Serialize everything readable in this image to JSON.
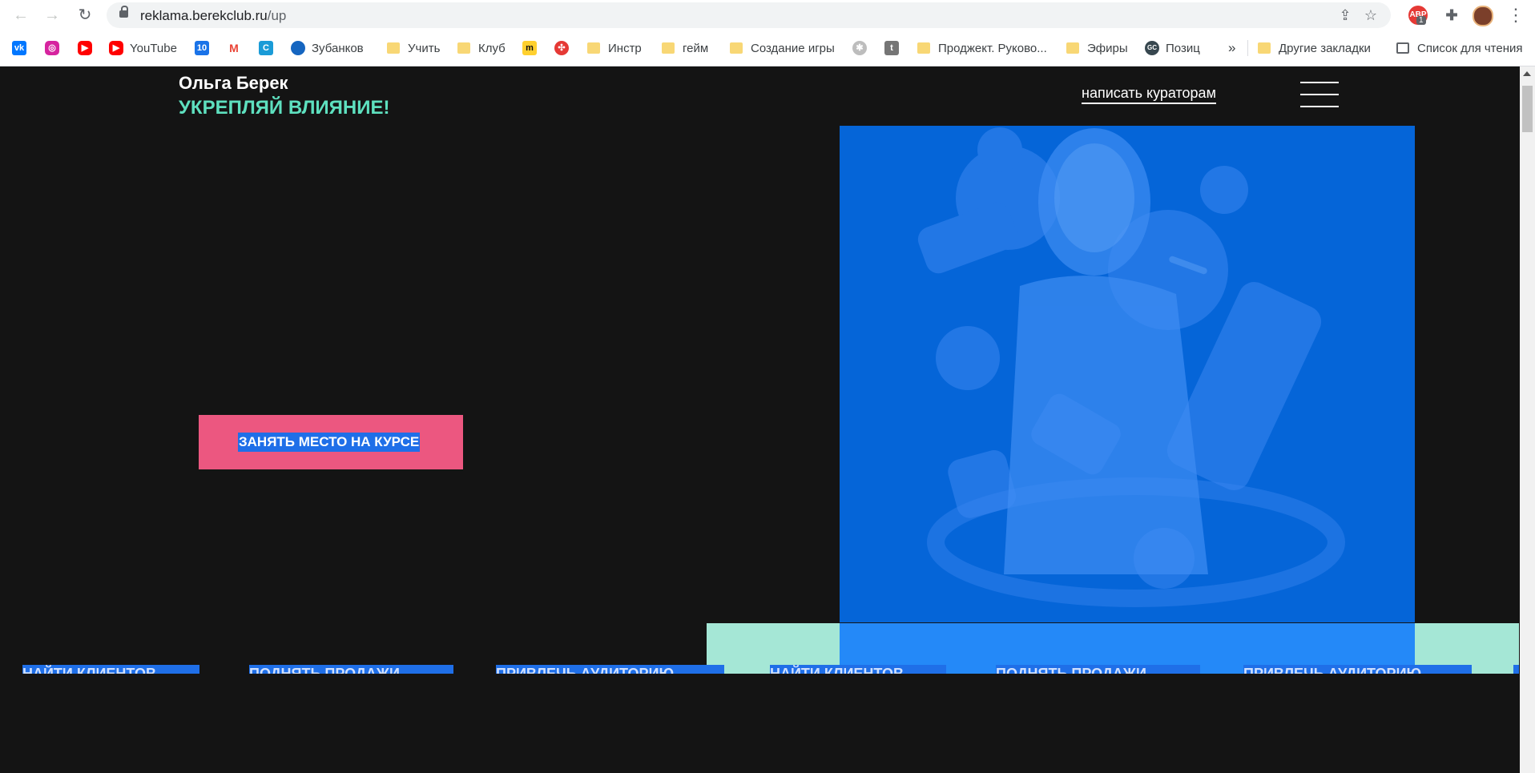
{
  "browser": {
    "url_host": "reklama.berekclub.ru",
    "url_path": "/up",
    "extension_badge": "1",
    "adblock_label": "ABP"
  },
  "bookmarks": [
    {
      "label": "",
      "icon": "vk-icon",
      "color": "#0077ff"
    },
    {
      "label": "",
      "icon": "instagram-icon",
      "color": "#d6249f"
    },
    {
      "label": "",
      "icon": "youtube-icon",
      "color": "#ff0000"
    },
    {
      "label": "YouTube",
      "icon": "youtube-icon",
      "color": "#ff0000"
    },
    {
      "label": "",
      "icon": "calendar-icon",
      "color": "#1a73e8"
    },
    {
      "label": "",
      "icon": "gmail-icon",
      "color": "#ea4335"
    },
    {
      "label": "",
      "icon": "c-icon",
      "color": "#1a9bd7"
    },
    {
      "label": "Зубанков",
      "icon": "cloud-icon",
      "color": "#1565c0"
    },
    {
      "label": "Учить",
      "icon": "folder-icon"
    },
    {
      "label": "Клуб",
      "icon": "folder-icon"
    },
    {
      "label": "",
      "icon": "miro-icon",
      "color": "#ffd02f"
    },
    {
      "label": "",
      "icon": "lifebuoy-icon",
      "color": "#e53935"
    },
    {
      "label": "Инстр",
      "icon": "folder-icon"
    },
    {
      "label": "гейм",
      "icon": "folder-icon"
    },
    {
      "label": "Создание игры",
      "icon": "folder-icon"
    },
    {
      "label": "",
      "icon": "gear-gray-icon",
      "color": "#bdbdbd"
    },
    {
      "label": "",
      "icon": "t-icon",
      "color": "#757575"
    },
    {
      "label": "Проджект. Руково...",
      "icon": "folder-icon"
    },
    {
      "label": "Эфиры",
      "icon": "folder-icon"
    },
    {
      "label": "Позиц",
      "icon": "gc-icon",
      "color": "#37474f"
    },
    {
      "label": "»",
      "icon": "more-bookmarks"
    },
    {
      "label": "Другие закладки",
      "icon": "folder-icon"
    },
    {
      "label": "Список для чтения",
      "icon": "reading-list-icon"
    }
  ],
  "header": {
    "name": "Ольга Берек",
    "slogan": "УКРЕПЛЯЙ ВЛИЯНИЕ!",
    "curators_link": "написать кураторам"
  },
  "hero": {
    "cta_label": "ЗАНЯТЬ МЕСТО НА КУРСЕ"
  },
  "ticker": [
    "НАЙТИ КЛИЕНТОВ",
    "ПОДНЯТЬ ПРОДАЖИ",
    "ПРИВЛЕЧЬ АУДИТОРИЮ",
    "НАЙТИ КЛИЕНТОВ",
    "ПОДНЯТЬ ПРОДАЖИ",
    "ПРИВЛЕЧЬ АУДИТОРИЮ"
  ],
  "colors": {
    "page_bg": "#141414",
    "accent_mint": "#5ee0bf",
    "cta_pink": "#ec5780",
    "photo_blue": "#0565d8",
    "selection_blue": "#1f6fe8"
  }
}
